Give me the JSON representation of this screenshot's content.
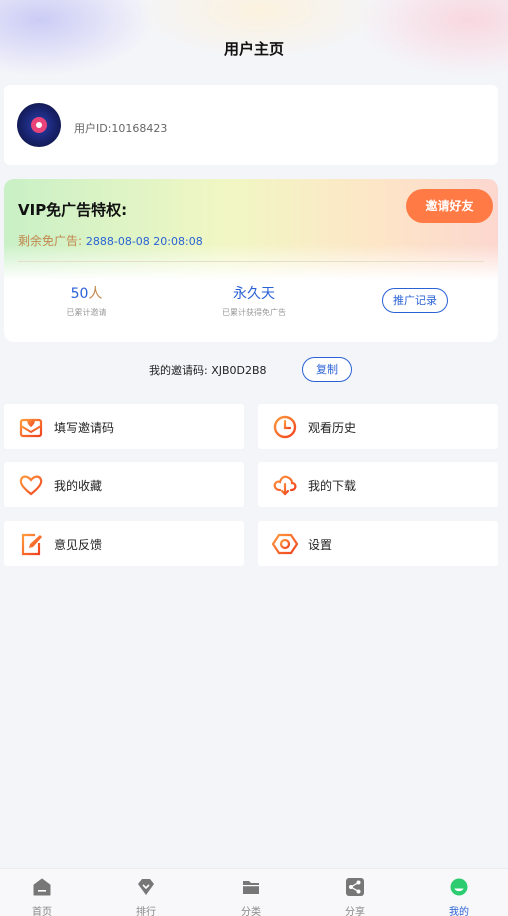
{
  "header": {
    "title": "用户主页"
  },
  "user": {
    "id_text": "用户ID:10168423"
  },
  "vip": {
    "title": "VIP免广告特权:",
    "invite_button": "邀请好友",
    "remaining_label": "剩余免广告:",
    "remaining_value": "2888-08-08 20:08:08",
    "stats": [
      {
        "value": "50",
        "unit": "人",
        "caption": "已累计邀请"
      },
      {
        "value": "永久天",
        "unit": "",
        "caption": "已累计获得免广告"
      }
    ],
    "record_button": "推广记录"
  },
  "invite": {
    "code_text": "我的邀请码: XJB0D2B8",
    "copy_button": "复制"
  },
  "menu": [
    {
      "label": "填写邀请码",
      "icon": "envelope-heart-icon"
    },
    {
      "label": "观看历史",
      "icon": "clock-icon"
    },
    {
      "label": "我的收藏",
      "icon": "heart-icon"
    },
    {
      "label": "我的下载",
      "icon": "cloud-download-icon"
    },
    {
      "label": "意见反馈",
      "icon": "edit-icon"
    },
    {
      "label": "设置",
      "icon": "hexagon-settings-icon"
    }
  ],
  "tabbar": [
    {
      "label": "首页",
      "icon": "home-icon",
      "active": false
    },
    {
      "label": "排行",
      "icon": "ranking-icon",
      "active": false
    },
    {
      "label": "分类",
      "icon": "folder-icon",
      "active": false
    },
    {
      "label": "分享",
      "icon": "share-icon",
      "active": false
    },
    {
      "label": "我的",
      "icon": "profile-icon",
      "active": true
    }
  ],
  "colors": {
    "accent_blue": "#2a62d6",
    "accent_orange": "#ff7a45",
    "active_tab": "#2ecc71",
    "inactive_tab": "#777777"
  }
}
